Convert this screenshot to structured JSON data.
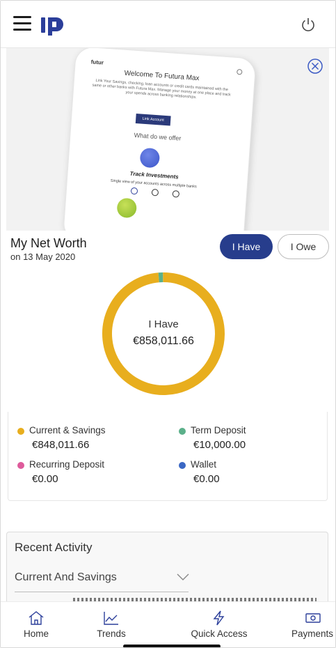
{
  "header": {
    "menu_icon": "hamburger-menu-icon",
    "logo_icon": "futura-logo-icon",
    "logout_icon": "power-icon"
  },
  "banner": {
    "brand": "futur",
    "title": "Welcome To Futura Max",
    "description": "Link Your Savings, checking, loan accounts or credit cards maintained with the same or other banks with Futura Max. Manage your money at one place and track your spends across banking relationships.",
    "button": "Link Account",
    "offer_heading": "What do we offer",
    "feature_title": "Track Investments",
    "feature_subtitle": "Single view of your accounts across multiple banks",
    "close_icon": "close-circle-icon"
  },
  "net_worth": {
    "title": "My Net Worth",
    "date": "on 13 May 2020",
    "toggle_have": "I Have",
    "toggle_owe": "I Owe",
    "center_label": "I Have",
    "center_value": "€858,011.66",
    "colors": {
      "current_savings": "#e8ae1e",
      "term_deposit": "#5bb08a",
      "recurring_deposit": "#de5b9b",
      "wallet": "#3a67c4",
      "toggle_active": "#273d8c"
    }
  },
  "chart_data": {
    "type": "pie",
    "categories": [
      "Current & Savings",
      "Term Deposit",
      "Recurring Deposit",
      "Wallet"
    ],
    "values": [
      848011.66,
      10000.0,
      0.0,
      0.0
    ],
    "title": "",
    "center_text": "€858,011.66"
  },
  "legend": [
    {
      "label": "Current & Savings",
      "value": "€848,011.66",
      "color": "#e8ae1e"
    },
    {
      "label": "Term Deposit",
      "value": "€10,000.00",
      "color": "#5bb08a"
    },
    {
      "label": "Recurring Deposit",
      "value": "€0.00",
      "color": "#de5b9b"
    },
    {
      "label": "Wallet",
      "value": "€0.00",
      "color": "#3a67c4"
    }
  ],
  "recent_activity": {
    "title": "Recent Activity",
    "selected": "Current And Savings",
    "chevron_icon": "chevron-down-icon"
  },
  "bottom_nav": [
    {
      "label": "Home",
      "icon": "home-icon"
    },
    {
      "label": "Trends",
      "icon": "trends-icon"
    },
    {
      "label": "Quick Access",
      "icon": "lightning-icon"
    },
    {
      "label": "Payments",
      "icon": "payments-icon"
    }
  ]
}
